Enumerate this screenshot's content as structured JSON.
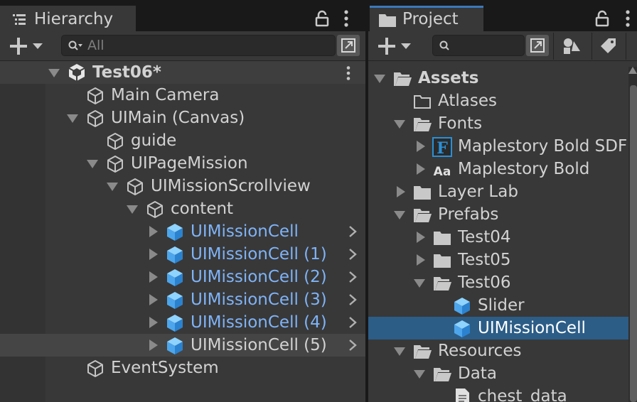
{
  "hierarchy": {
    "tab_label": "Hierarchy",
    "search_placeholder": "All",
    "scene": "Test06*",
    "items": [
      {
        "label": "Main Camera",
        "depth": 1,
        "expander": "none",
        "icon": "gameobject",
        "prefab": false
      },
      {
        "label": "UIMain (Canvas)",
        "depth": 1,
        "expander": "down",
        "icon": "gameobject",
        "prefab": false
      },
      {
        "label": "guide",
        "depth": 2,
        "expander": "none",
        "icon": "gameobject",
        "prefab": false
      },
      {
        "label": "UIPageMission",
        "depth": 2,
        "expander": "down",
        "icon": "gameobject",
        "prefab": false
      },
      {
        "label": "UIMissionScrollview",
        "depth": 3,
        "expander": "down",
        "icon": "gameobject",
        "prefab": false
      },
      {
        "label": "content",
        "depth": 4,
        "expander": "down",
        "icon": "gameobject",
        "prefab": false
      },
      {
        "label": "UIMissionCell",
        "depth": 5,
        "expander": "right",
        "icon": "prefab",
        "prefab": true
      },
      {
        "label": "UIMissionCell (1)",
        "depth": 5,
        "expander": "right",
        "icon": "prefab",
        "prefab": true
      },
      {
        "label": "UIMissionCell (2)",
        "depth": 5,
        "expander": "right",
        "icon": "prefab",
        "prefab": true
      },
      {
        "label": "UIMissionCell (3)",
        "depth": 5,
        "expander": "right",
        "icon": "prefab",
        "prefab": true
      },
      {
        "label": "UIMissionCell (4)",
        "depth": 5,
        "expander": "right",
        "icon": "prefab",
        "prefab": true
      },
      {
        "label": "UIMissionCell (5)",
        "depth": 5,
        "expander": "right",
        "icon": "prefab",
        "prefab": true,
        "hovered": true
      },
      {
        "label": "EventSystem",
        "depth": 1,
        "expander": "none",
        "icon": "gameobject",
        "prefab": false
      }
    ]
  },
  "project": {
    "tab_label": "Project",
    "search_placeholder": "",
    "items": [
      {
        "label": "Assets",
        "depth": 0,
        "expander": "down",
        "icon": "folder-open",
        "bold": true
      },
      {
        "label": "Atlases",
        "depth": 1,
        "expander": "none",
        "icon": "folder-empty"
      },
      {
        "label": "Fonts",
        "depth": 1,
        "expander": "down",
        "icon": "folder-open"
      },
      {
        "label": "Maplestory Bold SDF",
        "depth": 2,
        "expander": "right",
        "icon": "font-asset"
      },
      {
        "label": "Maplestory Bold",
        "depth": 2,
        "expander": "right",
        "icon": "font"
      },
      {
        "label": "Layer Lab",
        "depth": 1,
        "expander": "right",
        "icon": "folder"
      },
      {
        "label": "Prefabs",
        "depth": 1,
        "expander": "down",
        "icon": "folder-open"
      },
      {
        "label": "Test04",
        "depth": 2,
        "expander": "right",
        "icon": "folder"
      },
      {
        "label": "Test05",
        "depth": 2,
        "expander": "right",
        "icon": "folder"
      },
      {
        "label": "Test06",
        "depth": 2,
        "expander": "down",
        "icon": "folder-open"
      },
      {
        "label": "Slider",
        "depth": 3,
        "expander": "none",
        "icon": "prefab"
      },
      {
        "label": "UIMissionCell",
        "depth": 3,
        "expander": "none",
        "icon": "prefab",
        "selected": true
      },
      {
        "label": "Resources",
        "depth": 1,
        "expander": "down",
        "icon": "folder-open"
      },
      {
        "label": "Data",
        "depth": 2,
        "expander": "down",
        "icon": "folder-open"
      },
      {
        "label": "chest_data",
        "depth": 3,
        "expander": "none",
        "icon": "text-file"
      }
    ]
  },
  "colors": {
    "accent": "#3a79bb",
    "prefab_text": "#7fb3f7",
    "selected_row": "#2c5d87"
  }
}
